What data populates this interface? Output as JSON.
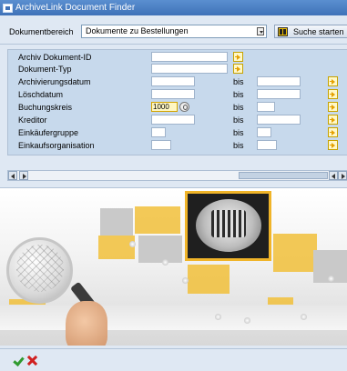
{
  "window": {
    "title": "ArchiveLink Document Finder"
  },
  "toolbar": {
    "dokumentbereich_label": "Dokumentbereich",
    "dokumentbereich_value": "Dokumente zu Bestellungen",
    "search_label": "Suche starten"
  },
  "form": {
    "bis_label": "bis",
    "rows": [
      {
        "label": "Archiv Dokument-ID",
        "value": "",
        "to_value": ""
      },
      {
        "label": "Dokument-Typ",
        "value": "",
        "to_value": ""
      },
      {
        "label": "Archivierungsdatum",
        "value": "",
        "to_value": ""
      },
      {
        "label": "Löschdatum",
        "value": "",
        "to_value": ""
      },
      {
        "label": "Buchungskreis",
        "value": "1000",
        "to_value": ""
      },
      {
        "label": "Kreditor",
        "value": "",
        "to_value": ""
      },
      {
        "label": "Einkäufergruppe",
        "value": "",
        "to_value": ""
      },
      {
        "label": "Einkaufsorganisation",
        "value": "",
        "to_value": ""
      }
    ]
  },
  "colors": {
    "accent_yellow": "#f0b429",
    "title_blue": "#3f72b8",
    "panel_blue": "#c7d9ec"
  },
  "icons": {
    "search": "binoculars-icon",
    "multi_select": "arrow-right-icon",
    "help": "search-help-icon",
    "ok": "check-icon",
    "cancel": "cancel-x-icon"
  }
}
